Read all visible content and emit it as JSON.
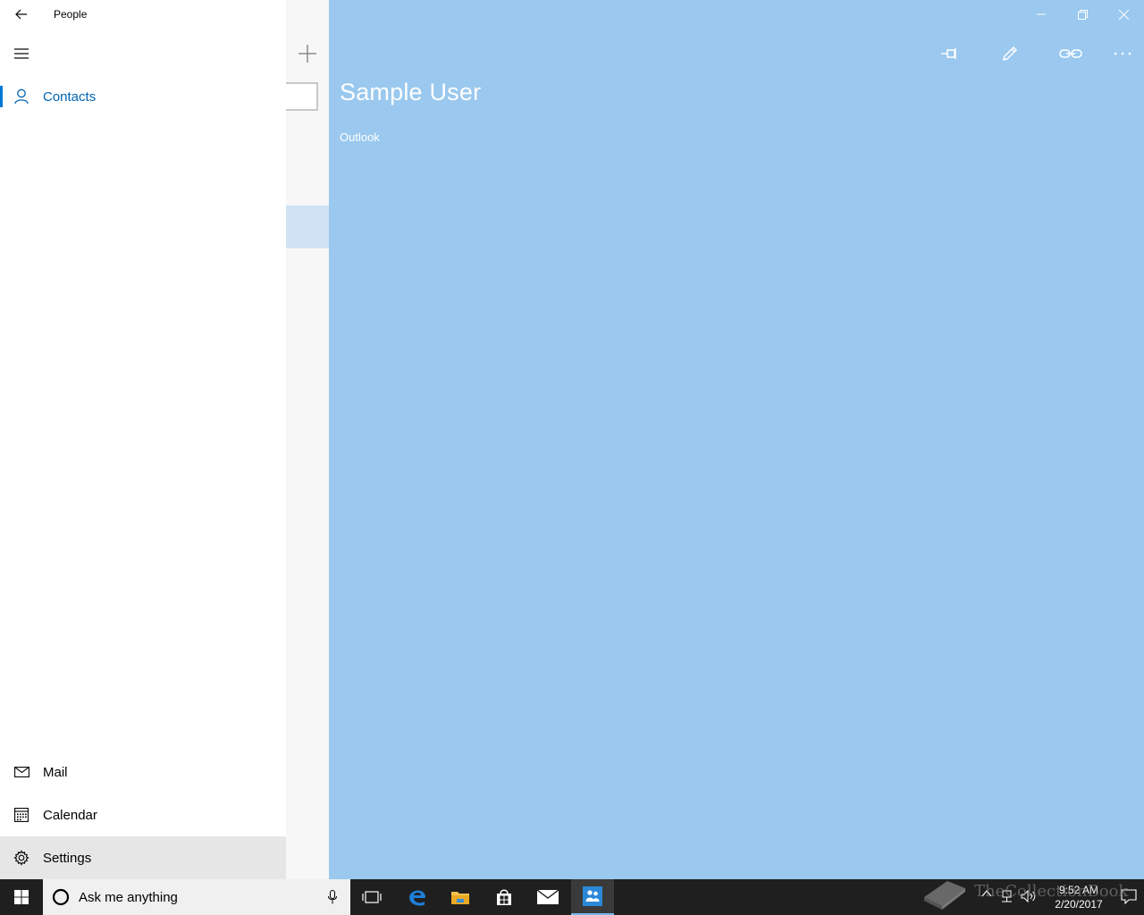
{
  "app": {
    "title": "People"
  },
  "nav": {
    "items": [
      {
        "label": "Contacts",
        "icon": "person-icon",
        "active": true
      }
    ],
    "bottom_items": [
      {
        "label": "Mail",
        "icon": "mail-icon"
      },
      {
        "label": "Calendar",
        "icon": "calendar-icon"
      },
      {
        "label": "Settings",
        "icon": "gear-icon"
      }
    ]
  },
  "contact": {
    "name": "Sample User",
    "source": "Outlook"
  },
  "toolbar": {
    "pin_icon": "pin-icon",
    "edit_icon": "pencil-icon",
    "link_icon": "link-icon",
    "more_icon": "ellipsis-icon"
  },
  "taskbar": {
    "search_placeholder": "Ask me anything",
    "time": "9:52 AM",
    "date": "2/20/2017"
  },
  "watermark": {
    "text": "TheCollectionBook"
  },
  "colors": {
    "accent": "#0078d7",
    "detail_bg": "#9ac8ee",
    "taskbar_bg": "#1f1f1f"
  }
}
